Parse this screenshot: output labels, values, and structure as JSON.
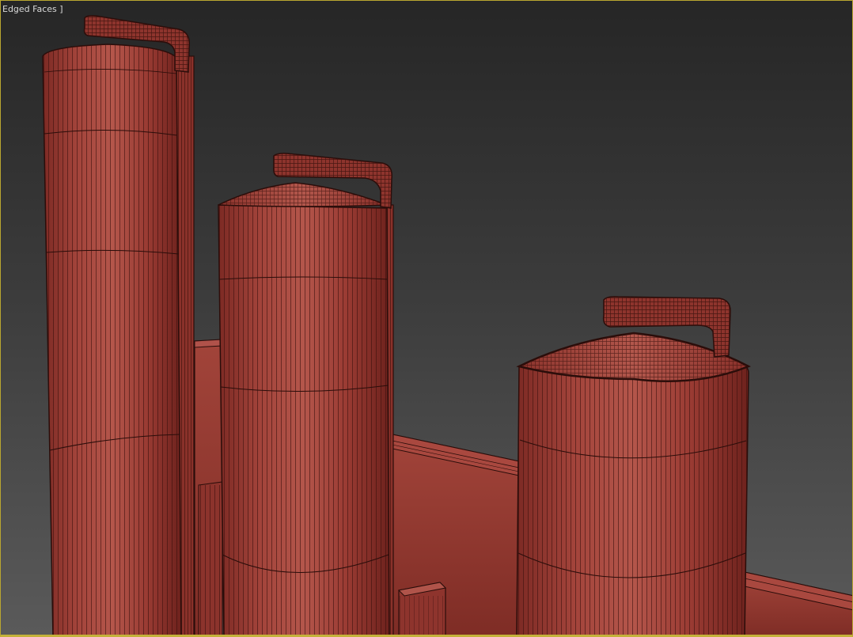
{
  "viewport": {
    "label": "Edged Faces ]",
    "frame_color": "#b9a630",
    "model_color": "#9a3b33",
    "edge_color": "#2a0d0a"
  }
}
